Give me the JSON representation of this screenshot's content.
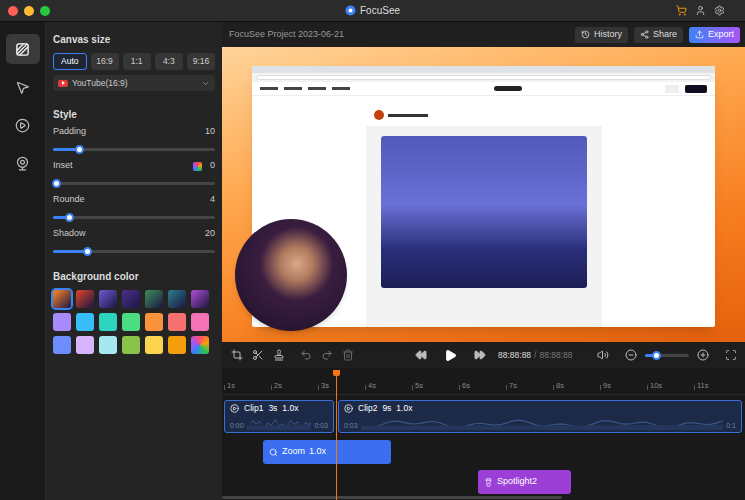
{
  "window": {
    "title": "FocuSee",
    "traffic_lights": [
      {
        "color": "#ff5f57"
      },
      {
        "color": "#febc2e"
      },
      {
        "color": "#28c840"
      }
    ]
  },
  "rail": [
    {
      "selected": true
    },
    {
      "selected": false
    },
    {
      "selected": false
    },
    {
      "selected": false
    }
  ],
  "panel": {
    "canvas_size": {
      "title": "Canvas size",
      "options": [
        {
          "label": "Auto",
          "selected": true
        },
        {
          "label": "16:9",
          "selected": false
        },
        {
          "label": "1:1",
          "selected": false
        },
        {
          "label": "4:3",
          "selected": false
        },
        {
          "label": "9:16",
          "selected": false
        }
      ],
      "preset": "YouTube(16:9)"
    },
    "style": {
      "title": "Style",
      "sliders": [
        {
          "label": "Padding",
          "value": "10",
          "level": 0.16,
          "kind": "plain"
        },
        {
          "label": "Inset",
          "value": "0",
          "level": 0.02,
          "kind": "color"
        },
        {
          "label": "Rounde",
          "value": "4",
          "level": 0.1,
          "kind": "plain"
        },
        {
          "label": "Shadow",
          "value": "20",
          "level": 0.21,
          "kind": "plain"
        }
      ]
    },
    "background": {
      "title": "Background color",
      "swatches": [
        {
          "kind": "wallpaper",
          "color": "#ff8a2a",
          "selected": true
        },
        {
          "kind": "wallpaper",
          "color": "#e0452b",
          "selected": false
        },
        {
          "kind": "wallpaper",
          "color": "#6d5cd6",
          "selected": false
        },
        {
          "kind": "wallpaper",
          "color": "#4b2f8f",
          "selected": false
        },
        {
          "kind": "wallpaper",
          "color": "#3f8f5a",
          "selected": false
        },
        {
          "kind": "wallpaper",
          "color": "#2f7d8f",
          "selected": false
        },
        {
          "kind": "wallpaper",
          "color": "#b04fd6",
          "selected": false
        },
        {
          "kind": "solid",
          "color": "#a78bfa",
          "selected": false
        },
        {
          "kind": "solid",
          "color": "#38bdf8",
          "selected": false
        },
        {
          "kind": "solid",
          "color": "#2dd4bf",
          "selected": false
        },
        {
          "kind": "solid",
          "color": "#4ade80",
          "selected": false
        },
        {
          "kind": "solid",
          "color": "#fb923c",
          "selected": false
        },
        {
          "kind": "solid",
          "color": "#f87171",
          "selected": false
        },
        {
          "kind": "solid",
          "color": "#f472b6",
          "selected": false
        },
        {
          "kind": "solid",
          "color": "#6d8dff",
          "selected": false
        },
        {
          "kind": "solid",
          "color": "#d8b4fe",
          "selected": false
        },
        {
          "kind": "solid",
          "color": "#a5e8f0",
          "selected": false
        },
        {
          "kind": "solid",
          "color": "#8bc34a",
          "selected": false
        },
        {
          "kind": "solid",
          "color": "#fcd34d",
          "selected": false
        },
        {
          "kind": "solid",
          "color": "#f59e0b",
          "selected": false
        },
        {
          "kind": "picker",
          "color": "#ff4d6d",
          "selected": false
        }
      ]
    }
  },
  "project": {
    "name": "FocuSee Project 2023-06-21",
    "actions": [
      {
        "label": "History",
        "primary": false
      },
      {
        "label": "Share",
        "primary": false
      },
      {
        "label": "Export",
        "primary": true
      }
    ]
  },
  "controls": {
    "current_time": "88:88:88",
    "separator": "/",
    "total_time": "88:88:88",
    "zoom_level": 0.25
  },
  "timeline": {
    "ruler": [
      "1s",
      "2s",
      "3s",
      "4s",
      "5s",
      "6s",
      "7s",
      "8s",
      "9s",
      "10s",
      "11s"
    ],
    "clips": [
      {
        "label": "Clip1",
        "duration": "3s",
        "speed": "1.0x",
        "start": "0:00",
        "end": "0:03"
      },
      {
        "label": "Clip2",
        "duration": "9s",
        "speed": "1.0x",
        "start": "0:03",
        "end": "0:1"
      }
    ],
    "effects": [
      {
        "label": "Zoom",
        "speed": "1.0x",
        "kind": "zoom",
        "color": "#3b6ff0"
      },
      {
        "label": "Spotlight2",
        "speed": "",
        "kind": "spotlight",
        "color": "#9b3fd6"
      }
    ]
  }
}
